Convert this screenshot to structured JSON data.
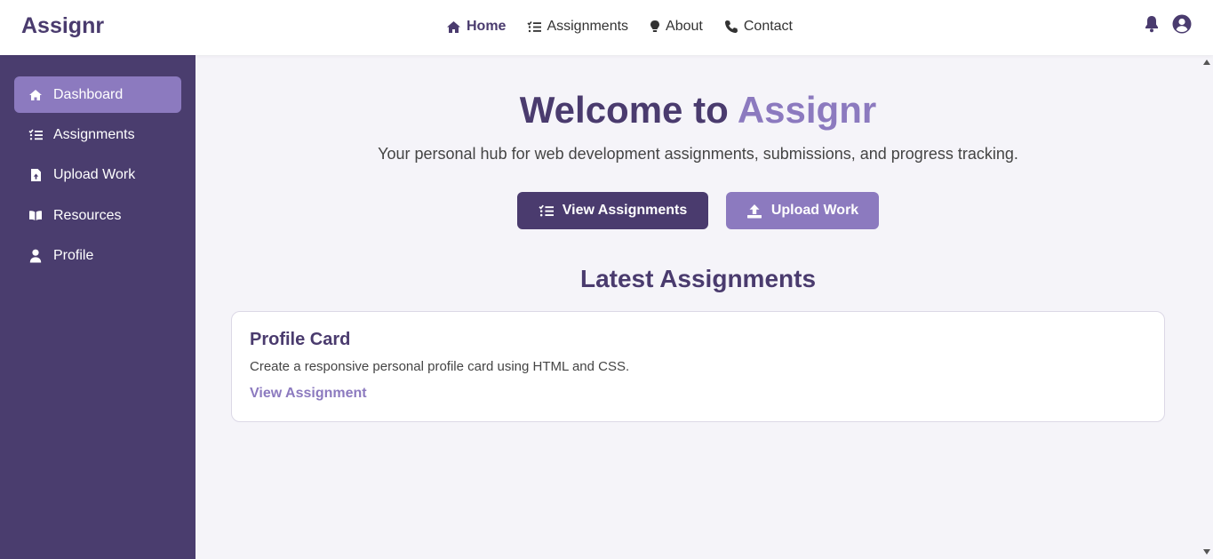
{
  "brand": "Assignr",
  "topnav": [
    {
      "label": "Home",
      "icon": "home-icon",
      "active": true
    },
    {
      "label": "Assignments",
      "icon": "list-check-icon"
    },
    {
      "label": "About",
      "icon": "lightbulb-icon"
    },
    {
      "label": "Contact",
      "icon": "phone-icon"
    }
  ],
  "top_icons": [
    "bell-icon",
    "user-circle-icon"
  ],
  "sidebar": {
    "items": [
      {
        "label": "Dashboard",
        "icon": "home-icon",
        "active": true
      },
      {
        "label": "Assignments",
        "icon": "list-check-icon"
      },
      {
        "label": "Upload Work",
        "icon": "file-upload-icon"
      },
      {
        "label": "Resources",
        "icon": "book-open-icon"
      },
      {
        "label": "Profile",
        "icon": "user-icon"
      }
    ]
  },
  "hero": {
    "title_prefix": "Welcome to",
    "title_accent": "Assignr",
    "subtitle": "Your personal hub for web development assignments, submissions, and progress tracking."
  },
  "actions": {
    "view_assignments": "View Assignments",
    "upload_work": "Upload Work"
  },
  "latest": {
    "title": "Latest Assignments",
    "cards": [
      {
        "title": "Profile Card",
        "description": "Create a responsive personal profile card using HTML and CSS.",
        "link": "View Assignment"
      }
    ]
  },
  "colors": {
    "primary": "#4a3b6e",
    "accent": "#8c7abf",
    "background": "#f5f4f9"
  }
}
